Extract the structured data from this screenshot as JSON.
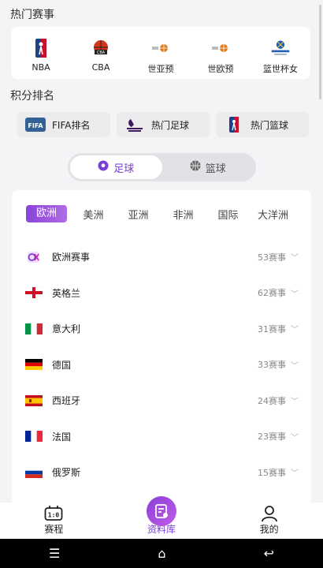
{
  "hot": {
    "title": "热门赛事",
    "items": [
      {
        "label": "NBA",
        "icon": "nba-logo-icon"
      },
      {
        "label": "CBA",
        "icon": "cba-logo-icon"
      },
      {
        "label": "世亚预",
        "icon": "fiba-logo-icon"
      },
      {
        "label": "世欧预",
        "icon": "fiba-logo-icon"
      },
      {
        "label": "篮世杯女",
        "icon": "world-cup-logo-icon"
      }
    ]
  },
  "ranking": {
    "title": "积分排名",
    "buttons": [
      {
        "label": "FIFA排名",
        "icon": "fifa-logo-icon"
      },
      {
        "label": "热门足球",
        "icon": "premier-league-logo-icon"
      },
      {
        "label": "热门篮球",
        "icon": "nba-logo-icon"
      }
    ]
  },
  "sport_toggle": {
    "football": "足球",
    "basketball": "篮球",
    "active": "football"
  },
  "regions": [
    "欧洲",
    "美洲",
    "亚洲",
    "非洲",
    "国际",
    "大洋洲"
  ],
  "active_region": "欧洲",
  "leagues": [
    {
      "name": "欧洲赛事",
      "count": "53赛事",
      "flag": "uefa"
    },
    {
      "name": "英格兰",
      "count": "62赛事",
      "flag": "england"
    },
    {
      "name": "意大利",
      "count": "31赛事",
      "flag": "italy"
    },
    {
      "name": "德国",
      "count": "33赛事",
      "flag": "germany"
    },
    {
      "name": "西班牙",
      "count": "24赛事",
      "flag": "spain"
    },
    {
      "name": "法国",
      "count": "23赛事",
      "flag": "france"
    },
    {
      "name": "俄罗斯",
      "count": "15赛事",
      "flag": "russia"
    }
  ],
  "nav": {
    "schedule": "赛程",
    "database": "资料库",
    "mine": "我的"
  },
  "colors": {
    "accent": "#7a3fd6"
  }
}
